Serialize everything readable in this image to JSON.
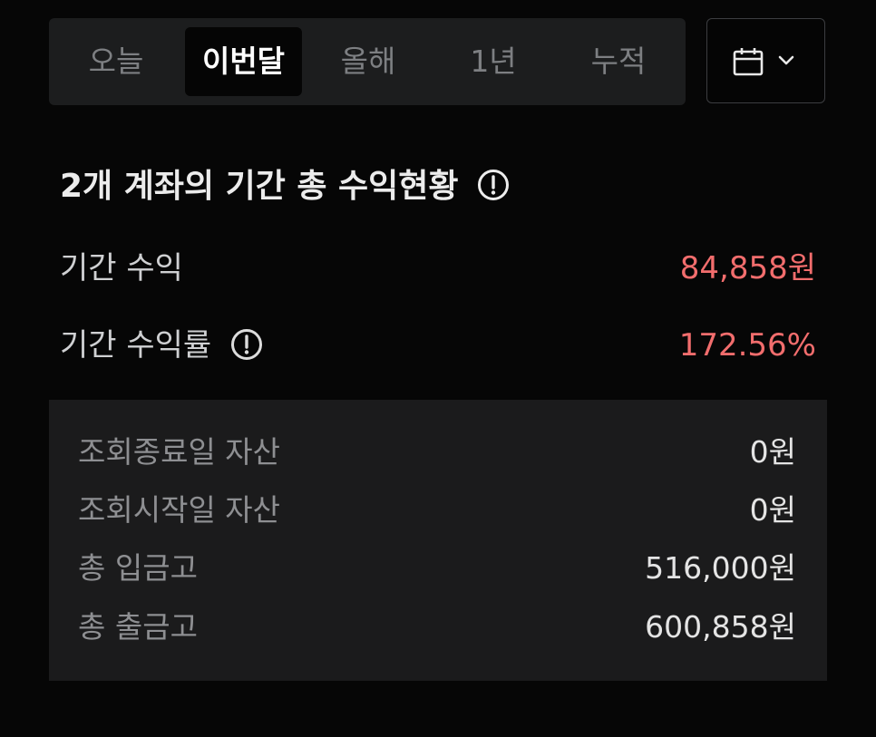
{
  "tabs": [
    {
      "label": "오늘",
      "active": false
    },
    {
      "label": "이번달",
      "active": true
    },
    {
      "label": "올해",
      "active": false
    },
    {
      "label": "1년",
      "active": false
    },
    {
      "label": "누적",
      "active": false
    }
  ],
  "calendar": {
    "icon": "calendar-icon",
    "dropdown_icon": "chevron-down-icon"
  },
  "summary": {
    "title": "2개 계좌의 기간 총 수익현황",
    "period_profit_label": "기간 수익",
    "period_profit_value": "84,858원",
    "period_return_label": "기간 수익률",
    "period_return_value": "172.56%"
  },
  "details": [
    {
      "label": "조회종료일 자산",
      "value": "0원"
    },
    {
      "label": "조회시작일 자산",
      "value": "0원"
    },
    {
      "label": "총 입금고",
      "value": "516,000원"
    },
    {
      "label": "총 출금고",
      "value": "600,858원"
    }
  ],
  "colors": {
    "profit": "#f26d6d",
    "background": "#060606",
    "panel": "#1b1b1c"
  }
}
